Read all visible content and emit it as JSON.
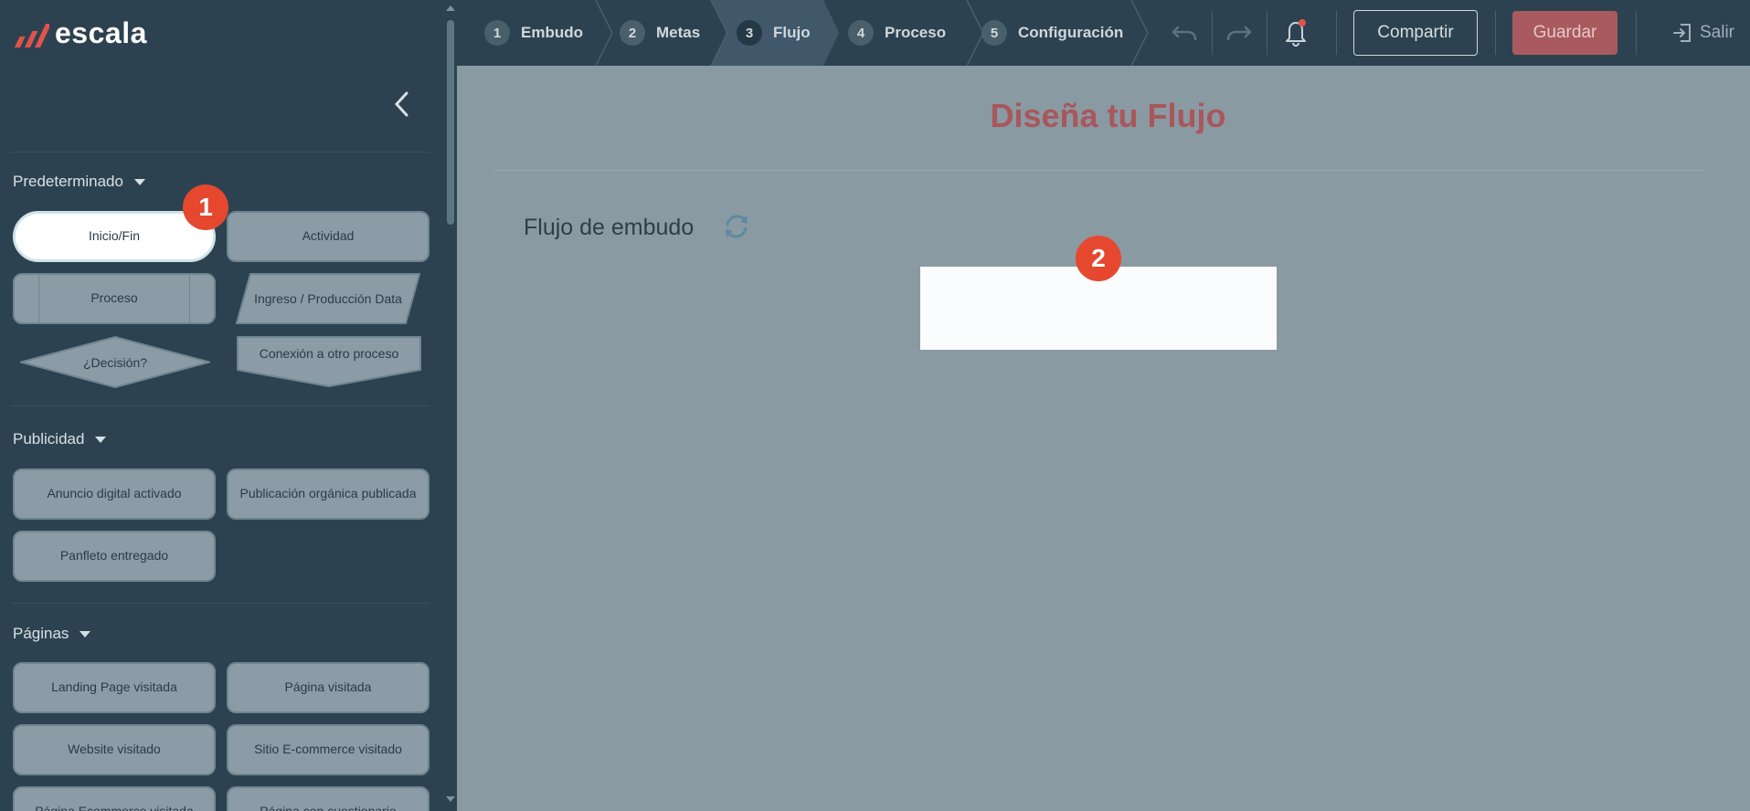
{
  "brand": {
    "name": "escala",
    "mark_color": "#e0534b"
  },
  "sidebar": {
    "sections": [
      {
        "title": "Predeterminado",
        "items": [
          "Inicio/Fin",
          "Actividad",
          "Proceso",
          "Ingreso / Producción Data",
          "¿Decisión?",
          "Conexión a otro proceso"
        ]
      },
      {
        "title": "Publicidad",
        "items": [
          "Anuncio digital activado",
          "Publicación orgánica publicada",
          "Panfleto entregado"
        ]
      },
      {
        "title": "Páginas",
        "items": [
          "Landing Page visitada",
          "Página visitada",
          "Website visitado",
          "Sitio E-commerce visitado",
          "Página Ecommerce visitada",
          "Página con cuestionario"
        ]
      }
    ]
  },
  "steps": [
    {
      "num": "1",
      "label": "Embudo"
    },
    {
      "num": "2",
      "label": "Metas"
    },
    {
      "num": "3",
      "label": "Flujo"
    },
    {
      "num": "4",
      "label": "Proceso"
    },
    {
      "num": "5",
      "label": "Configuración"
    }
  ],
  "toolbar": {
    "share_label": "Compartir",
    "save_label": "Guardar",
    "logout_label": "Salir",
    "undo_icon": "undo-icon",
    "redo_icon": "redo-icon",
    "bell_icon": "bell-icon"
  },
  "main": {
    "title": "Diseña tu Flujo",
    "flow_label": "Flujo de embudo"
  },
  "badges": [
    "1",
    "2"
  ],
  "colors": {
    "sidebar_bg": "#2d4250",
    "main_bg": "#8a9aa3",
    "accent": "#a8575b",
    "badge": "#e5482f"
  }
}
